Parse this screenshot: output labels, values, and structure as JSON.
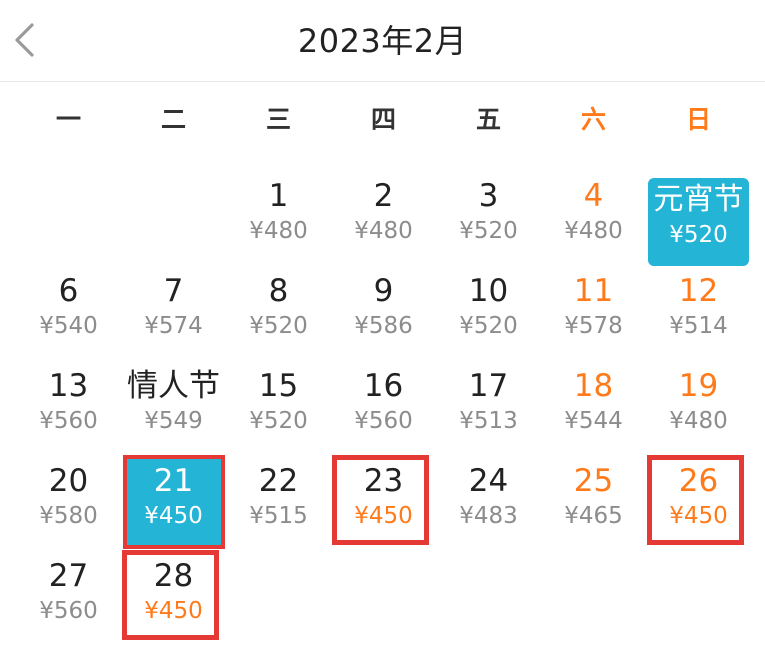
{
  "header": {
    "title": "2023年2月",
    "back_icon": "chevron-left-icon"
  },
  "weekdays": [
    "一",
    "二",
    "三",
    "四",
    "五",
    "六",
    "日"
  ],
  "accent_colors": {
    "selected": "#23b4d6",
    "weekend": "#ff7a1a",
    "highlight_frame": "#e53935"
  },
  "rows": [
    [
      {
        "day": "",
        "price": ""
      },
      {
        "day": "",
        "price": ""
      },
      {
        "day": "1",
        "price": "¥480"
      },
      {
        "day": "2",
        "price": "¥480"
      },
      {
        "day": "3",
        "price": "¥520"
      },
      {
        "day": "4",
        "price": "¥480"
      },
      {
        "day": "元宵节",
        "price": "¥520"
      }
    ],
    [
      {
        "day": "6",
        "price": "¥540"
      },
      {
        "day": "7",
        "price": "¥574"
      },
      {
        "day": "8",
        "price": "¥520"
      },
      {
        "day": "9",
        "price": "¥586"
      },
      {
        "day": "10",
        "price": "¥520"
      },
      {
        "day": "11",
        "price": "¥578"
      },
      {
        "day": "12",
        "price": "¥514"
      }
    ],
    [
      {
        "day": "13",
        "price": "¥560"
      },
      {
        "day": "情人节",
        "price": "¥549"
      },
      {
        "day": "15",
        "price": "¥520"
      },
      {
        "day": "16",
        "price": "¥560"
      },
      {
        "day": "17",
        "price": "¥513"
      },
      {
        "day": "18",
        "price": "¥544"
      },
      {
        "day": "19",
        "price": "¥480"
      }
    ],
    [
      {
        "day": "20",
        "price": "¥580"
      },
      {
        "day": "21",
        "price": "¥450"
      },
      {
        "day": "22",
        "price": "¥515"
      },
      {
        "day": "23",
        "price": "¥450"
      },
      {
        "day": "24",
        "price": "¥483"
      },
      {
        "day": "25",
        "price": "¥465"
      },
      {
        "day": "26",
        "price": "¥450"
      }
    ],
    [
      {
        "day": "27",
        "price": "¥560"
      },
      {
        "day": "28",
        "price": "¥450"
      },
      {
        "day": "",
        "price": ""
      },
      {
        "day": "",
        "price": ""
      },
      {
        "day": "",
        "price": ""
      },
      {
        "day": "",
        "price": ""
      },
      {
        "day": "",
        "price": ""
      }
    ]
  ]
}
